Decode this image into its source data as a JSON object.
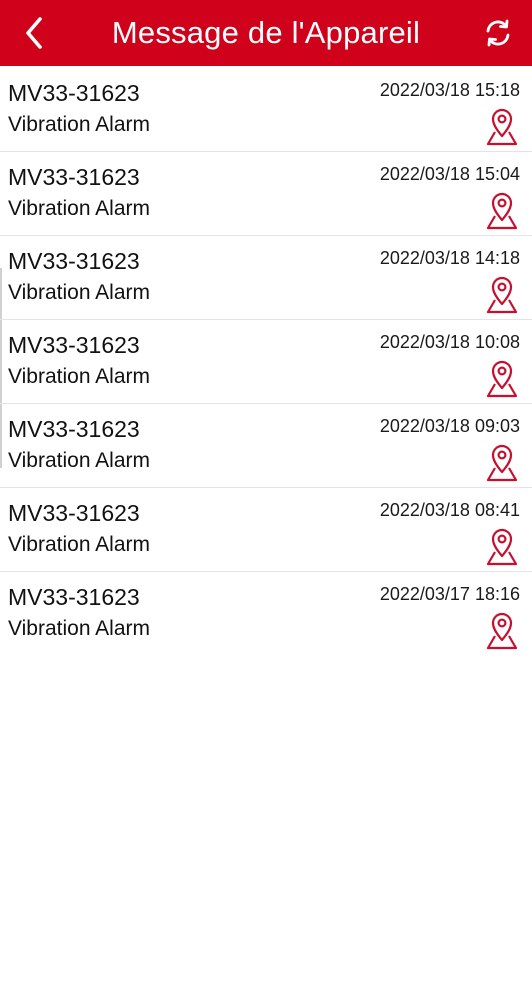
{
  "header": {
    "title": "Message de l'Appareil",
    "back_icon": "chevron-left-icon",
    "refresh_icon": "refresh-icon",
    "background_color": "#d0021b"
  },
  "messages": [
    {
      "device": "MV33-31623",
      "type": "Vibration Alarm",
      "time": "2022/03/18 15:18",
      "icon": "map-pin-icon"
    },
    {
      "device": "MV33-31623",
      "type": "Vibration Alarm",
      "time": "2022/03/18 15:04",
      "icon": "map-pin-icon"
    },
    {
      "device": "MV33-31623",
      "type": "Vibration Alarm",
      "time": "2022/03/18 14:18",
      "icon": "map-pin-icon"
    },
    {
      "device": "MV33-31623",
      "type": "Vibration Alarm",
      "time": "2022/03/18 10:08",
      "icon": "map-pin-icon"
    },
    {
      "device": "MV33-31623",
      "type": "Vibration Alarm",
      "time": "2022/03/18 09:03",
      "icon": "map-pin-icon"
    },
    {
      "device": "MV33-31623",
      "type": "Vibration Alarm",
      "time": "2022/03/18 08:41",
      "icon": "map-pin-icon"
    },
    {
      "device": "MV33-31623",
      "type": "Vibration Alarm",
      "time": "2022/03/17 18:16",
      "icon": "map-pin-icon"
    }
  ],
  "colors": {
    "accent": "#d0021b",
    "icon": "#c8102e"
  }
}
